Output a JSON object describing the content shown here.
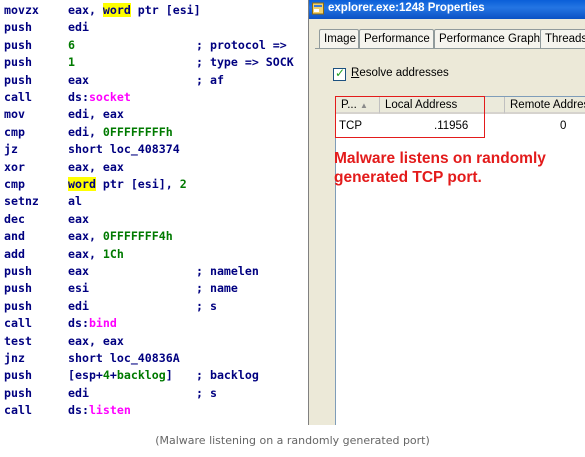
{
  "disassembly": [
    {
      "op": "movzx",
      "args": [
        {
          "t": "eax, "
        },
        {
          "t": "word",
          "k": "hl"
        },
        {
          "t": " ptr [esi]"
        }
      ],
      "comment": []
    },
    {
      "op": "push",
      "args": [
        {
          "t": "edi"
        }
      ],
      "comment": []
    },
    {
      "op": "push",
      "args": [
        {
          "t": "6",
          "k": "num"
        }
      ],
      "comment": [
        {
          "t": "; protocol =>"
        }
      ]
    },
    {
      "op": "push",
      "args": [
        {
          "t": "1",
          "k": "num"
        }
      ],
      "comment": [
        {
          "t": "; type => SOCK"
        }
      ]
    },
    {
      "op": "push",
      "args": [
        {
          "t": "eax"
        }
      ],
      "comment": [
        {
          "t": "; af"
        }
      ]
    },
    {
      "op": "call",
      "args": [
        {
          "t": "ds:"
        },
        {
          "t": "socket",
          "k": "api"
        }
      ],
      "comment": []
    },
    {
      "op": "mov",
      "args": [
        {
          "t": "edi, eax"
        }
      ],
      "comment": []
    },
    {
      "op": "cmp",
      "args": [
        {
          "t": "edi, "
        },
        {
          "t": "0FFFFFFFFh",
          "k": "num"
        }
      ],
      "comment": []
    },
    {
      "op": "jz",
      "args": [
        {
          "t": "short loc_408374"
        }
      ],
      "comment": []
    },
    {
      "op": "xor",
      "args": [
        {
          "t": "eax, eax"
        }
      ],
      "comment": []
    },
    {
      "op": "cmp",
      "args": [
        {
          "t": "word",
          "k": "hl"
        },
        {
          "t": " ptr [esi], "
        },
        {
          "t": "2",
          "k": "num"
        }
      ],
      "comment": []
    },
    {
      "op": "setnz",
      "args": [
        {
          "t": "al"
        }
      ],
      "comment": []
    },
    {
      "op": "dec",
      "args": [
        {
          "t": "eax"
        }
      ],
      "comment": []
    },
    {
      "op": "and",
      "args": [
        {
          "t": "eax, "
        },
        {
          "t": "0FFFFFFF4h",
          "k": "num"
        }
      ],
      "comment": []
    },
    {
      "op": "add",
      "args": [
        {
          "t": "eax, "
        },
        {
          "t": "1Ch",
          "k": "num"
        }
      ],
      "comment": []
    },
    {
      "op": "push",
      "args": [
        {
          "t": "eax"
        }
      ],
      "comment": [
        {
          "t": "; namelen"
        }
      ]
    },
    {
      "op": "push",
      "args": [
        {
          "t": "esi"
        }
      ],
      "comment": [
        {
          "t": "; name"
        }
      ]
    },
    {
      "op": "push",
      "args": [
        {
          "t": "edi"
        }
      ],
      "comment": [
        {
          "t": "; s"
        }
      ]
    },
    {
      "op": "call",
      "args": [
        {
          "t": "ds:"
        },
        {
          "t": "bind",
          "k": "api"
        }
      ],
      "comment": []
    },
    {
      "op": "test",
      "args": [
        {
          "t": "eax, eax"
        }
      ],
      "comment": []
    },
    {
      "op": "jnz",
      "args": [
        {
          "t": "short loc_40836A"
        }
      ],
      "comment": []
    },
    {
      "op": "push",
      "args": [
        {
          "t": "[esp+"
        },
        {
          "t": "4",
          "k": "num"
        },
        {
          "t": "+"
        },
        {
          "t": "backlog",
          "k": "num"
        },
        {
          "t": "]"
        }
      ],
      "comment": [
        {
          "t": "; backlog"
        }
      ]
    },
    {
      "op": "push",
      "args": [
        {
          "t": "edi"
        }
      ],
      "comment": [
        {
          "t": "; s"
        }
      ]
    },
    {
      "op": "call",
      "args": [
        {
          "t": "ds:"
        },
        {
          "t": "listen",
          "k": "api"
        }
      ],
      "comment": []
    }
  ],
  "window": {
    "title": "explorer.exe:1248 Properties",
    "tabs": [
      "Image",
      "Performance",
      "Performance Graph",
      "Threads"
    ],
    "resolve_checkbox": {
      "checked": true,
      "label_underlined": "R",
      "label_rest": "esolve addresses"
    },
    "columns": [
      "P...",
      "Local Address",
      "Remote Address"
    ],
    "sort_indicator": "▲",
    "rows": [
      {
        "protocol": "TCP",
        "local_address": ".11956",
        "remote_address": "0"
      }
    ],
    "annotation": "Malware listens on randomly generated TCP port."
  },
  "caption": "(Malware listening on a randomly generated port)",
  "colors": {
    "instruction": "#000080",
    "number": "#007a00",
    "api_call": "#ff00ff",
    "highlight": "#ffff00",
    "annotation": "#e31b1b",
    "titlebar": "#0a5fd8"
  }
}
